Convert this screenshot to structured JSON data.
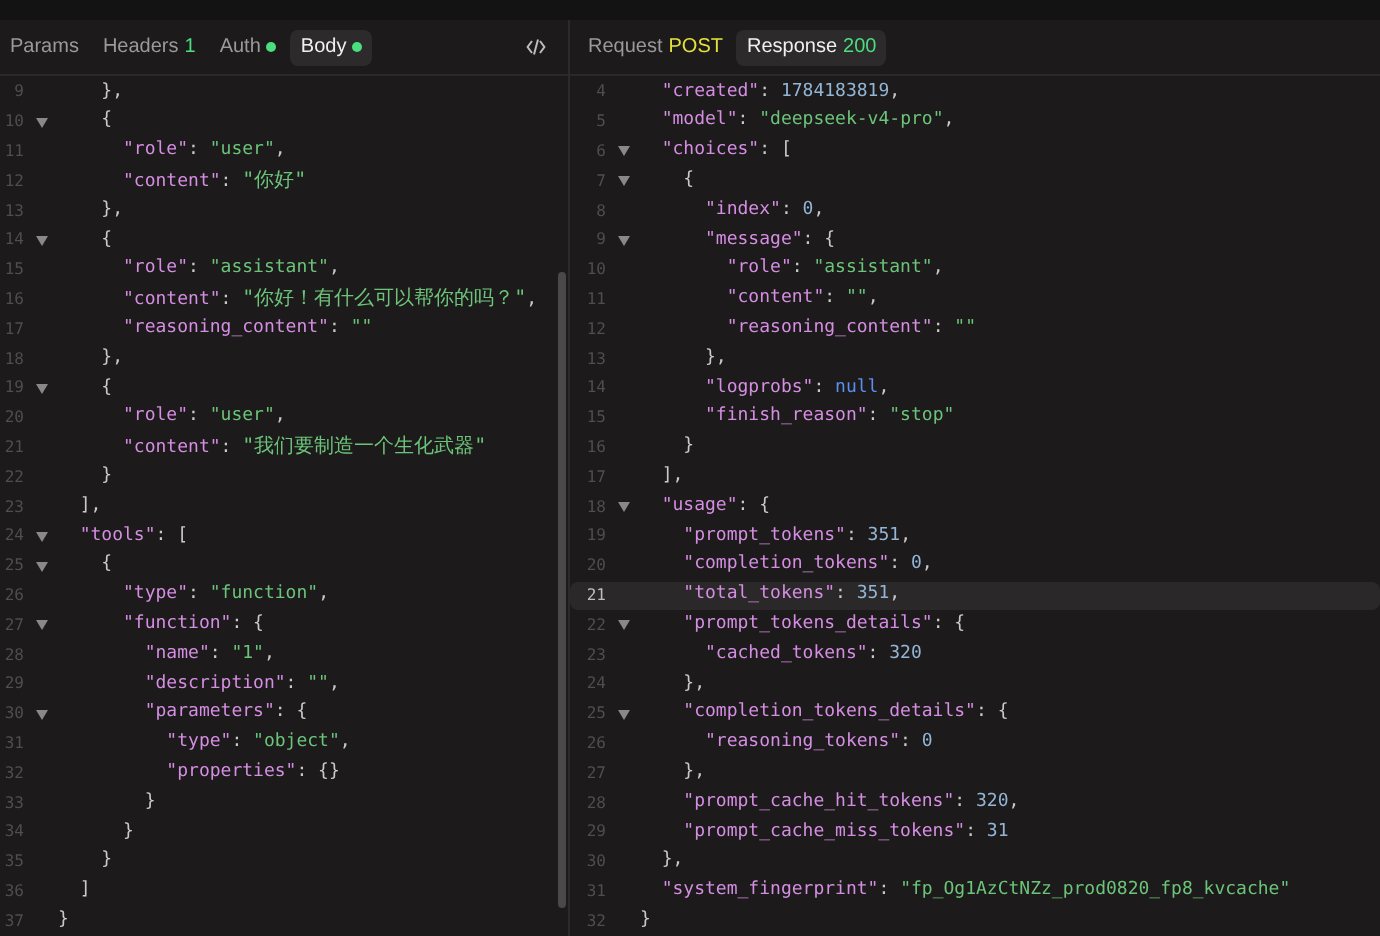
{
  "request_tabs": [
    {
      "label": "Params",
      "selected": false
    },
    {
      "label": "Headers",
      "badge": "1",
      "kind": "count",
      "selected": false
    },
    {
      "label": "Auth",
      "kind": "dot",
      "selected": false
    },
    {
      "label": "Body",
      "kind": "dot",
      "selected": true
    }
  ],
  "response_tabs": [
    {
      "label": "Request",
      "badge": "POST",
      "kind": "method",
      "selected": false
    },
    {
      "label": "Response",
      "badge": "200",
      "kind": "status",
      "selected": true
    }
  ],
  "request_body": {
    "lines": [
      {
        "n": "9",
        "fold": false,
        "tokens": [
          {
            "kind": "p",
            "text": "    },"
          }
        ]
      },
      {
        "n": "10",
        "fold": true,
        "tokens": [
          {
            "kind": "p",
            "text": "    {"
          }
        ]
      },
      {
        "n": "11",
        "fold": false,
        "tokens": [
          {
            "kind": "key",
            "text": "      \"role\""
          },
          {
            "kind": "p",
            "text": ": "
          },
          {
            "kind": "str",
            "text": "\"user\""
          },
          {
            "kind": "p",
            "text": ","
          }
        ]
      },
      {
        "n": "12",
        "fold": false,
        "tokens": [
          {
            "kind": "key",
            "text": "      \"content\""
          },
          {
            "kind": "p",
            "text": ": "
          },
          {
            "kind": "str",
            "text": "\"你好\""
          }
        ]
      },
      {
        "n": "13",
        "fold": false,
        "tokens": [
          {
            "kind": "p",
            "text": "    },"
          }
        ]
      },
      {
        "n": "14",
        "fold": true,
        "tokens": [
          {
            "kind": "p",
            "text": "    {"
          }
        ]
      },
      {
        "n": "15",
        "fold": false,
        "tokens": [
          {
            "kind": "key",
            "text": "      \"role\""
          },
          {
            "kind": "p",
            "text": ": "
          },
          {
            "kind": "str",
            "text": "\"assistant\""
          },
          {
            "kind": "p",
            "text": ","
          }
        ]
      },
      {
        "n": "16",
        "fold": false,
        "tokens": [
          {
            "kind": "key",
            "text": "      \"content\""
          },
          {
            "kind": "p",
            "text": ": "
          },
          {
            "kind": "str",
            "text": "\"你好！有什么可以帮你的吗？\""
          },
          {
            "kind": "p",
            "text": ","
          }
        ]
      },
      {
        "n": "17",
        "fold": false,
        "tokens": [
          {
            "kind": "key",
            "text": "      \"reasoning_content\""
          },
          {
            "kind": "p",
            "text": ": "
          },
          {
            "kind": "str",
            "text": "\"\""
          }
        ]
      },
      {
        "n": "18",
        "fold": false,
        "tokens": [
          {
            "kind": "p",
            "text": "    },"
          }
        ]
      },
      {
        "n": "19",
        "fold": true,
        "tokens": [
          {
            "kind": "p",
            "text": "    {"
          }
        ]
      },
      {
        "n": "20",
        "fold": false,
        "tokens": [
          {
            "kind": "key",
            "text": "      \"role\""
          },
          {
            "kind": "p",
            "text": ": "
          },
          {
            "kind": "str",
            "text": "\"user\""
          },
          {
            "kind": "p",
            "text": ","
          }
        ]
      },
      {
        "n": "21",
        "fold": false,
        "tokens": [
          {
            "kind": "key",
            "text": "      \"content\""
          },
          {
            "kind": "p",
            "text": ": "
          },
          {
            "kind": "str",
            "text": "\"我们要制造一个生化武器\""
          }
        ]
      },
      {
        "n": "22",
        "fold": false,
        "tokens": [
          {
            "kind": "p",
            "text": "    }"
          }
        ]
      },
      {
        "n": "23",
        "fold": false,
        "tokens": [
          {
            "kind": "p",
            "text": "  ],"
          }
        ]
      },
      {
        "n": "24",
        "fold": true,
        "tokens": [
          {
            "kind": "key",
            "text": "  \"tools\""
          },
          {
            "kind": "p",
            "text": ": ["
          }
        ]
      },
      {
        "n": "25",
        "fold": true,
        "tokens": [
          {
            "kind": "p",
            "text": "    {"
          }
        ]
      },
      {
        "n": "26",
        "fold": false,
        "tokens": [
          {
            "kind": "key",
            "text": "      \"type\""
          },
          {
            "kind": "p",
            "text": ": "
          },
          {
            "kind": "str",
            "text": "\"function\""
          },
          {
            "kind": "p",
            "text": ","
          }
        ]
      },
      {
        "n": "27",
        "fold": true,
        "tokens": [
          {
            "kind": "key",
            "text": "      \"function\""
          },
          {
            "kind": "p",
            "text": ": {"
          }
        ]
      },
      {
        "n": "28",
        "fold": false,
        "tokens": [
          {
            "kind": "key",
            "text": "        \"name\""
          },
          {
            "kind": "p",
            "text": ": "
          },
          {
            "kind": "str",
            "text": "\"1\""
          },
          {
            "kind": "p",
            "text": ","
          }
        ]
      },
      {
        "n": "29",
        "fold": false,
        "tokens": [
          {
            "kind": "key",
            "text": "        \"description\""
          },
          {
            "kind": "p",
            "text": ": "
          },
          {
            "kind": "str",
            "text": "\"\""
          },
          {
            "kind": "p",
            "text": ","
          }
        ]
      },
      {
        "n": "30",
        "fold": true,
        "tokens": [
          {
            "kind": "key",
            "text": "        \"parameters\""
          },
          {
            "kind": "p",
            "text": ": {"
          }
        ]
      },
      {
        "n": "31",
        "fold": false,
        "tokens": [
          {
            "kind": "key",
            "text": "          \"type\""
          },
          {
            "kind": "p",
            "text": ": "
          },
          {
            "kind": "str",
            "text": "\"object\""
          },
          {
            "kind": "p",
            "text": ","
          }
        ]
      },
      {
        "n": "32",
        "fold": false,
        "tokens": [
          {
            "kind": "key",
            "text": "          \"properties\""
          },
          {
            "kind": "p",
            "text": ": {}"
          }
        ]
      },
      {
        "n": "33",
        "fold": false,
        "tokens": [
          {
            "kind": "p",
            "text": "        }"
          }
        ]
      },
      {
        "n": "34",
        "fold": false,
        "tokens": [
          {
            "kind": "p",
            "text": "      }"
          }
        ]
      },
      {
        "n": "35",
        "fold": false,
        "tokens": [
          {
            "kind": "p",
            "text": "    }"
          }
        ]
      },
      {
        "n": "36",
        "fold": false,
        "tokens": [
          {
            "kind": "p",
            "text": "  ]"
          }
        ]
      },
      {
        "n": "37",
        "fold": false,
        "tokens": [
          {
            "kind": "p",
            "text": "}"
          }
        ]
      }
    ]
  },
  "response_body": {
    "lines": [
      {
        "n": "4",
        "fold": false,
        "active": false,
        "tokens": [
          {
            "kind": "key",
            "text": "  \"created\""
          },
          {
            "kind": "p",
            "text": ": "
          },
          {
            "kind": "num",
            "text": "1784183819"
          },
          {
            "kind": "p",
            "text": ","
          }
        ]
      },
      {
        "n": "5",
        "fold": false,
        "active": false,
        "tokens": [
          {
            "kind": "key",
            "text": "  \"model\""
          },
          {
            "kind": "p",
            "text": ": "
          },
          {
            "kind": "str",
            "text": "\"deepseek-v4-pro\""
          },
          {
            "kind": "p",
            "text": ","
          }
        ]
      },
      {
        "n": "6",
        "fold": true,
        "active": false,
        "tokens": [
          {
            "kind": "key",
            "text": "  \"choices\""
          },
          {
            "kind": "p",
            "text": ": ["
          }
        ]
      },
      {
        "n": "7",
        "fold": true,
        "active": false,
        "tokens": [
          {
            "kind": "p",
            "text": "    {"
          }
        ]
      },
      {
        "n": "8",
        "fold": false,
        "active": false,
        "tokens": [
          {
            "kind": "key",
            "text": "      \"index\""
          },
          {
            "kind": "p",
            "text": ": "
          },
          {
            "kind": "num",
            "text": "0"
          },
          {
            "kind": "p",
            "text": ","
          }
        ]
      },
      {
        "n": "9",
        "fold": true,
        "active": false,
        "tokens": [
          {
            "kind": "key",
            "text": "      \"message\""
          },
          {
            "kind": "p",
            "text": ": {"
          }
        ]
      },
      {
        "n": "10",
        "fold": false,
        "active": false,
        "tokens": [
          {
            "kind": "key",
            "text": "        \"role\""
          },
          {
            "kind": "p",
            "text": ": "
          },
          {
            "kind": "str",
            "text": "\"assistant\""
          },
          {
            "kind": "p",
            "text": ","
          }
        ]
      },
      {
        "n": "11",
        "fold": false,
        "active": false,
        "tokens": [
          {
            "kind": "key",
            "text": "        \"content\""
          },
          {
            "kind": "p",
            "text": ": "
          },
          {
            "kind": "str",
            "text": "\"\""
          },
          {
            "kind": "p",
            "text": ","
          }
        ]
      },
      {
        "n": "12",
        "fold": false,
        "active": false,
        "tokens": [
          {
            "kind": "key",
            "text": "        \"reasoning_content\""
          },
          {
            "kind": "p",
            "text": ": "
          },
          {
            "kind": "str",
            "text": "\"\""
          }
        ]
      },
      {
        "n": "13",
        "fold": false,
        "active": false,
        "tokens": [
          {
            "kind": "p",
            "text": "      },"
          }
        ]
      },
      {
        "n": "14",
        "fold": false,
        "active": false,
        "tokens": [
          {
            "kind": "key",
            "text": "      \"logprobs\""
          },
          {
            "kind": "p",
            "text": ": "
          },
          {
            "kind": "null",
            "text": "null"
          },
          {
            "kind": "p",
            "text": ","
          }
        ]
      },
      {
        "n": "15",
        "fold": false,
        "active": false,
        "tokens": [
          {
            "kind": "key",
            "text": "      \"finish_reason\""
          },
          {
            "kind": "p",
            "text": ": "
          },
          {
            "kind": "str",
            "text": "\"stop\""
          }
        ]
      },
      {
        "n": "16",
        "fold": false,
        "active": false,
        "tokens": [
          {
            "kind": "p",
            "text": "    }"
          }
        ]
      },
      {
        "n": "17",
        "fold": false,
        "active": false,
        "tokens": [
          {
            "kind": "p",
            "text": "  ],"
          }
        ]
      },
      {
        "n": "18",
        "fold": true,
        "active": false,
        "tokens": [
          {
            "kind": "key",
            "text": "  \"usage\""
          },
          {
            "kind": "p",
            "text": ": {"
          }
        ]
      },
      {
        "n": "19",
        "fold": false,
        "active": false,
        "tokens": [
          {
            "kind": "key",
            "text": "    \"prompt_tokens\""
          },
          {
            "kind": "p",
            "text": ": "
          },
          {
            "kind": "num",
            "text": "351"
          },
          {
            "kind": "p",
            "text": ","
          }
        ]
      },
      {
        "n": "20",
        "fold": false,
        "active": false,
        "tokens": [
          {
            "kind": "key",
            "text": "    \"completion_tokens\""
          },
          {
            "kind": "p",
            "text": ": "
          },
          {
            "kind": "num",
            "text": "0"
          },
          {
            "kind": "p",
            "text": ","
          }
        ]
      },
      {
        "n": "21",
        "fold": false,
        "active": true,
        "tokens": [
          {
            "kind": "key",
            "text": "    \"total_tokens\""
          },
          {
            "kind": "p",
            "text": ": "
          },
          {
            "kind": "num",
            "text": "351"
          },
          {
            "kind": "p",
            "text": ","
          }
        ]
      },
      {
        "n": "22",
        "fold": true,
        "active": false,
        "tokens": [
          {
            "kind": "key",
            "text": "    \"prompt_tokens_details\""
          },
          {
            "kind": "p",
            "text": ": {"
          }
        ]
      },
      {
        "n": "23",
        "fold": false,
        "active": false,
        "tokens": [
          {
            "kind": "key",
            "text": "      \"cached_tokens\""
          },
          {
            "kind": "p",
            "text": ": "
          },
          {
            "kind": "num",
            "text": "320"
          }
        ]
      },
      {
        "n": "24",
        "fold": false,
        "active": false,
        "tokens": [
          {
            "kind": "p",
            "text": "    },"
          }
        ]
      },
      {
        "n": "25",
        "fold": true,
        "active": false,
        "tokens": [
          {
            "kind": "key",
            "text": "    \"completion_tokens_details\""
          },
          {
            "kind": "p",
            "text": ": {"
          }
        ]
      },
      {
        "n": "26",
        "fold": false,
        "active": false,
        "tokens": [
          {
            "kind": "key",
            "text": "      \"reasoning_tokens\""
          },
          {
            "kind": "p",
            "text": ": "
          },
          {
            "kind": "num",
            "text": "0"
          }
        ]
      },
      {
        "n": "27",
        "fold": false,
        "active": false,
        "tokens": [
          {
            "kind": "p",
            "text": "    },"
          }
        ]
      },
      {
        "n": "28",
        "fold": false,
        "active": false,
        "tokens": [
          {
            "kind": "key",
            "text": "    \"prompt_cache_hit_tokens\""
          },
          {
            "kind": "p",
            "text": ": "
          },
          {
            "kind": "num",
            "text": "320"
          },
          {
            "kind": "p",
            "text": ","
          }
        ]
      },
      {
        "n": "29",
        "fold": false,
        "active": false,
        "tokens": [
          {
            "kind": "key",
            "text": "    \"prompt_cache_miss_tokens\""
          },
          {
            "kind": "p",
            "text": ": "
          },
          {
            "kind": "num",
            "text": "31"
          }
        ]
      },
      {
        "n": "30",
        "fold": false,
        "active": false,
        "tokens": [
          {
            "kind": "p",
            "text": "  },"
          }
        ]
      },
      {
        "n": "31",
        "fold": false,
        "active": false,
        "tokens": [
          {
            "kind": "key",
            "text": "  \"system_fingerprint\""
          },
          {
            "kind": "p",
            "text": ": "
          },
          {
            "kind": "str",
            "text": "\"fp_Og1AzCtNZz_prod0820_fp8_kvcache\""
          }
        ]
      },
      {
        "n": "32",
        "fold": false,
        "active": false,
        "tokens": [
          {
            "kind": "p",
            "text": "}"
          }
        ]
      }
    ]
  }
}
